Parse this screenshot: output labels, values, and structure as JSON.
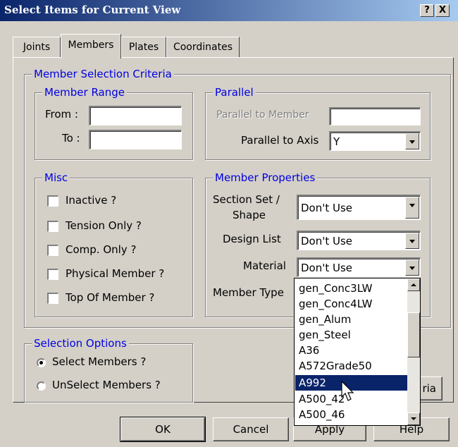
{
  "window": {
    "title": "Select Items for Current View",
    "help_glyph": "?",
    "close_glyph": "X"
  },
  "tabs": [
    "Joints",
    "Members",
    "Plates",
    "Coordinates"
  ],
  "member_range": {
    "legend": "Member Range",
    "from_label": "From :",
    "to_label": "To :",
    "from_value": "",
    "to_value": ""
  },
  "criteria": {
    "legend": "Member Selection Criteria"
  },
  "parallel": {
    "legend": "Parallel",
    "to_member_label": "Parallel to Member",
    "to_member_value": "",
    "to_axis_label": "Parallel to Axis",
    "to_axis_value": "Y"
  },
  "misc": {
    "legend": "Misc",
    "items": [
      "Inactive ?",
      "Tension Only ?",
      "Comp. Only ?",
      "Physical Member ?",
      "Top Of Member ?"
    ]
  },
  "properties": {
    "legend": "Member Properties",
    "section_label_1": "Section Set /",
    "section_label_2": "Shape",
    "section_value": "Don't Use",
    "design_label": "Design List",
    "design_value": "Don't Use",
    "material_label": "Material",
    "material_value": "Don't Use",
    "type_label": "Member Type"
  },
  "material_dropdown": {
    "items": [
      "gen_Conc3LW",
      "gen_Conc4LW",
      "gen_Alum",
      "gen_Steel",
      "A36",
      "A572Grade50",
      "A992",
      "A500_42",
      "A500_46"
    ],
    "selected": "A992"
  },
  "selection_options": {
    "legend": "Selection Options",
    "select_label": "Select Members ?",
    "unselect_label": "UnSelect Members ?",
    "selected": "Select Members ?"
  },
  "partial_button_label": "ria",
  "buttons": {
    "ok": "OK",
    "cancel": "Cancel",
    "apply": "Apply",
    "help": "Help"
  }
}
